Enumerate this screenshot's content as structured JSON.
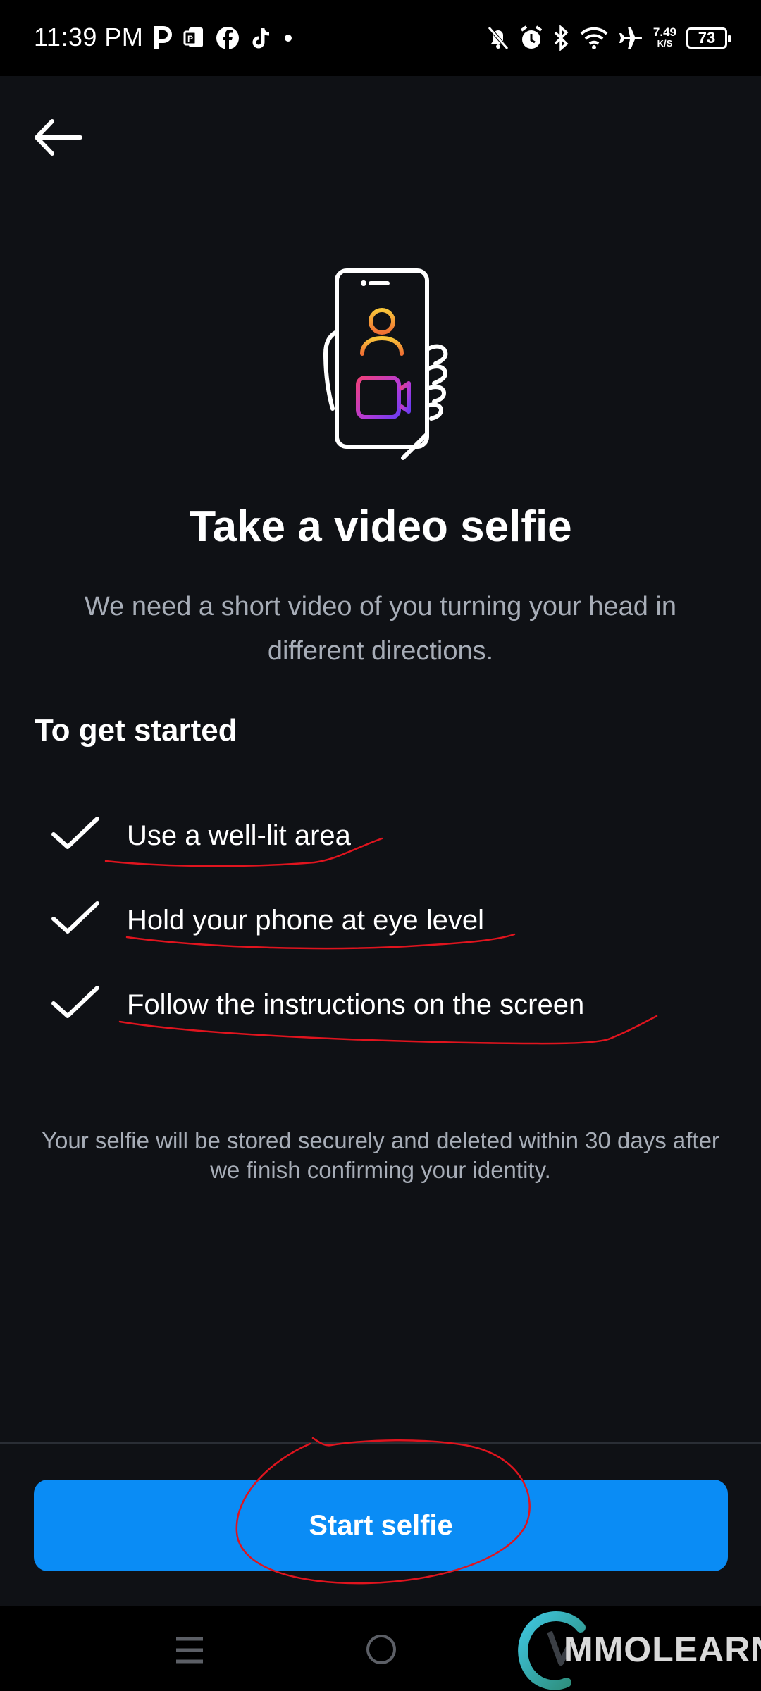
{
  "status_bar": {
    "time": "11:39 PM",
    "left_icons": [
      "p-icon",
      "pdf-icon",
      "facebook-icon",
      "tiktok-icon",
      "dot-icon"
    ],
    "right_icons": [
      "notifications-off-icon",
      "alarm-icon",
      "bluetooth-icon",
      "wifi-icon",
      "airplane-icon"
    ],
    "network_speed_value": "7.49",
    "network_speed_unit": "K/S",
    "battery": "73"
  },
  "header": {
    "back_icon": "arrow-left-icon"
  },
  "hero": {
    "icon": "phone-video-selfie-illustration"
  },
  "main": {
    "title": "Take a video selfie",
    "subtitle": "We need a short video of you turning your head in different directions.",
    "section_heading": "To get started",
    "checklist": [
      {
        "label": "Use a well-lit area"
      },
      {
        "label": "Hold your phone at eye level"
      },
      {
        "label": "Follow the instructions on the screen"
      }
    ],
    "footnote": "Your selfie will be stored securely and deleted within 30 days after we finish confirming your identity."
  },
  "footer": {
    "button_label": "Start selfie"
  },
  "nav_bar": {
    "icons": [
      "menu-icon",
      "home-icon"
    ]
  },
  "watermark": {
    "text": "MMOLEARN"
  },
  "colors": {
    "background": "#0f1115",
    "button": "#0a8cf5",
    "annotation": "#e0141e",
    "muted_text": "#a7adb7"
  }
}
